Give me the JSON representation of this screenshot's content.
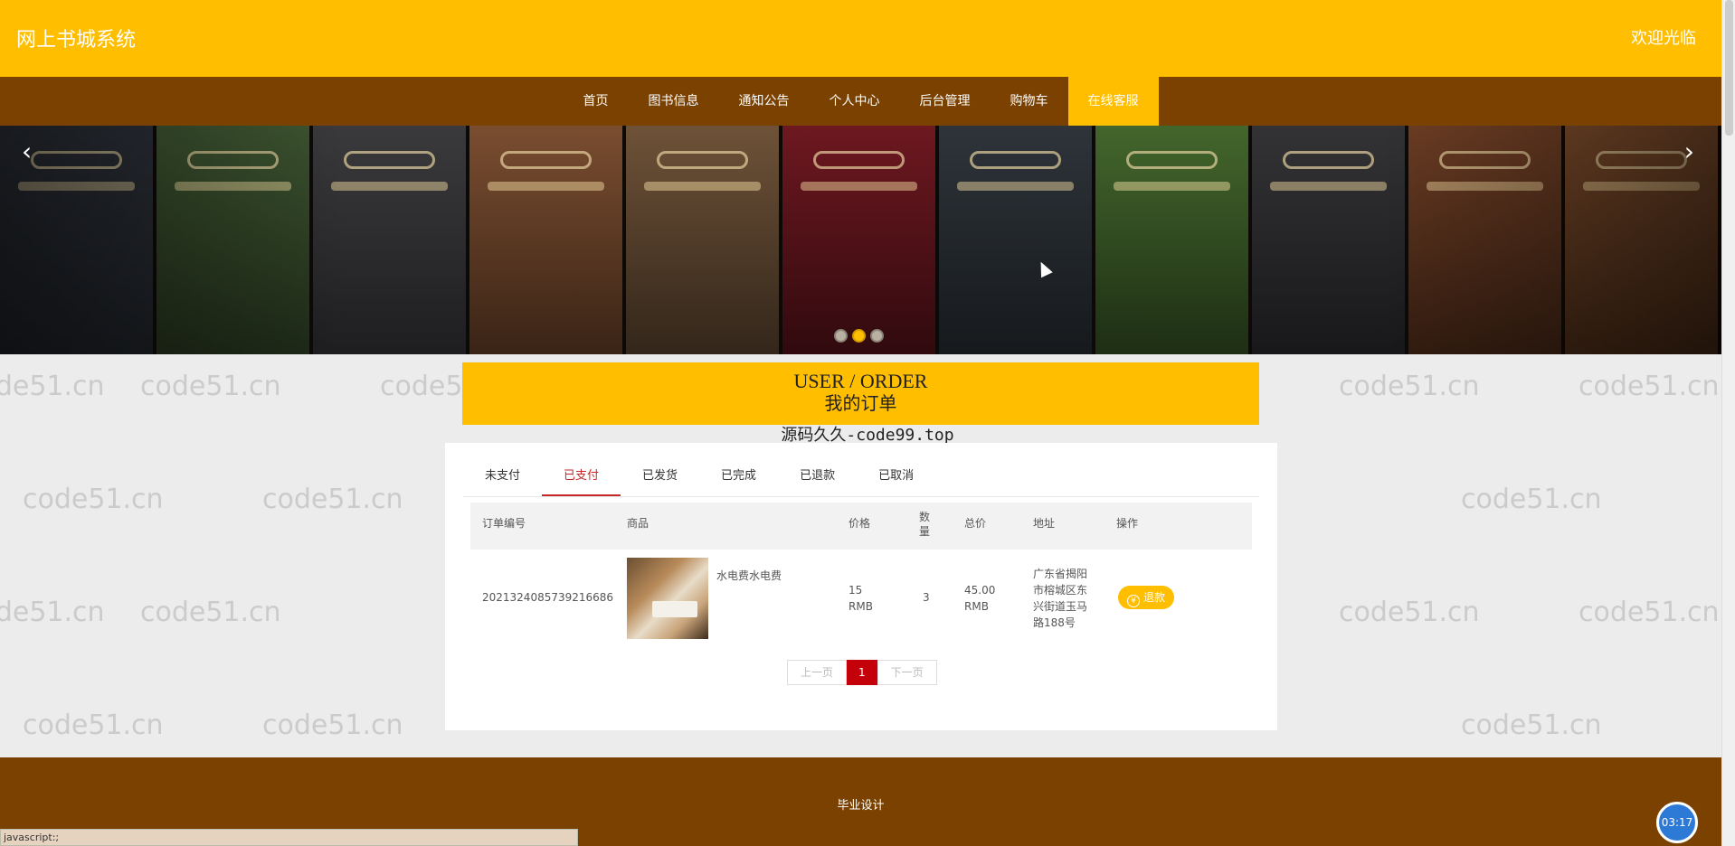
{
  "header": {
    "site_title": "网上书城系统",
    "welcome": "欢迎光临"
  },
  "nav": {
    "items": [
      {
        "label": "首页"
      },
      {
        "label": "图书信息"
      },
      {
        "label": "通知公告"
      },
      {
        "label": "个人中心"
      },
      {
        "label": "后台管理"
      },
      {
        "label": "购物车"
      },
      {
        "label": "在线客服"
      }
    ],
    "active_index": 6
  },
  "banner": {
    "prev_icon": "chevron-left-icon",
    "next_icon": "chevron-right-icon",
    "slide_count": 3,
    "active_slide": 1
  },
  "order_section": {
    "title_en": "USER / ORDER",
    "title_cn": "我的订单"
  },
  "watermark_text": "源码久久-code99.top",
  "background_watermark": "code51.cn",
  "tabs": [
    {
      "label": "未支付"
    },
    {
      "label": "已支付"
    },
    {
      "label": "已发货"
    },
    {
      "label": "已完成"
    },
    {
      "label": "已退款"
    },
    {
      "label": "已取消"
    }
  ],
  "active_tab": 1,
  "table": {
    "headers": {
      "order_no": "订单编号",
      "product": "商品",
      "price": "价格",
      "qty": "数量",
      "total": "总价",
      "address": "地址",
      "action": "操作"
    },
    "rows": [
      {
        "order_no": "2021324085739216686",
        "product": "水电费水电费",
        "price": "15 RMB",
        "qty": "3",
        "total": "45.00 RMB",
        "address": "广东省揭阳市榕城区东兴街道玉马路188号",
        "action": "退款",
        "action_icon": "¥"
      }
    ]
  },
  "pager": {
    "prev": "上一页",
    "current": "1",
    "next": "下一页"
  },
  "footer": {
    "text": "毕业设计"
  },
  "statusbar": {
    "text": "javascript:;"
  },
  "clock": {
    "time": "03:17"
  },
  "colors": {
    "header": "#ffbe00",
    "nav": "#7a4100",
    "accent_red": "#c62828"
  }
}
